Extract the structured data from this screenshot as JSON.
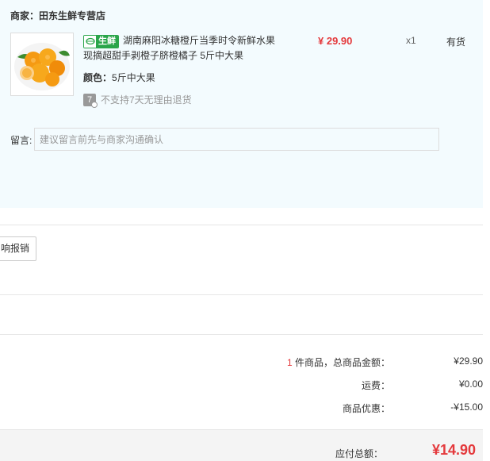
{
  "shop": {
    "label": "商家：田东生鲜专营店"
  },
  "item": {
    "image_icon": "orange-fruit-image",
    "tag_icon": "fresh-leaf-icon",
    "tag_text": "生鲜",
    "title": "湖南麻阳冰糖橙斤当季时令新鲜水果现摘超甜手剥橙子脐橙橘子 5斤中大果",
    "color_label": "颜色：",
    "color_value": "5斤中大果",
    "return_icon_text": "7",
    "return_note": "不支持7天无理由退货",
    "price": "¥ 29.90",
    "quantity": "x1",
    "stock": "有货"
  },
  "remark": {
    "label": "留言:",
    "placeholder": "建议留言前先与商家沟通确认"
  },
  "actions": {
    "report_button": "响报销"
  },
  "summary": {
    "count": "1",
    "count_label": " 件商品，总商品金额：",
    "goods_total": "¥29.90",
    "shipping_label": "运费：",
    "shipping_value": "¥0.00",
    "discount_label": "商品优惠：",
    "discount_value": "-¥15.00",
    "payable_label": "应付总额：",
    "payable_value": "¥14.90"
  },
  "colors": {
    "accent_red": "#e4393c",
    "fresh_green": "#2aa54a",
    "panel_bg": "#f3fbfe"
  }
}
